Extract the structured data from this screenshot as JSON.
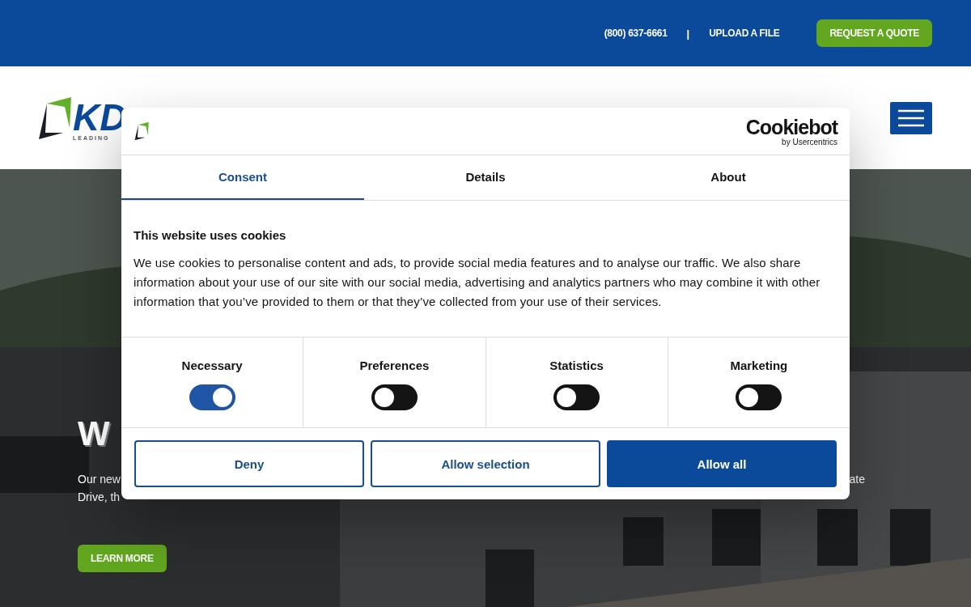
{
  "top_bar": {
    "phone": "(800) 637-6661",
    "separator": "|",
    "upload_link": "UPLOAD A FILE",
    "quote_button": "REQUEST A QUOTE"
  },
  "header": {
    "logo_letters": "KD",
    "logo_tagline": "LEADING"
  },
  "hero": {
    "heading": "W",
    "line_1_left": "Our new",
    "line_1_right": "ate",
    "line_2_left": "Drive, th",
    "button": "LEARN MORE"
  },
  "cookie_dialog": {
    "brand": "Cookiebot",
    "brand_sub": "by Usercentrics",
    "tabs": [
      {
        "label": "Consent",
        "selected": true
      },
      {
        "label": "Details",
        "selected": false
      },
      {
        "label": "About",
        "selected": false
      }
    ],
    "title": "This website uses cookies",
    "body": "We use cookies to personalise content and ads, to provide social media features and to analyse our traffic. We also share information about your use of our site with our social media, advertising and analytics partners who may combine it with other information that you’ve provided to them or that they’ve collected from your use of their services.",
    "categories": [
      {
        "label": "Necessary",
        "on": true
      },
      {
        "label": "Preferences",
        "on": false
      },
      {
        "label": "Statistics",
        "on": false
      },
      {
        "label": "Marketing",
        "on": false
      }
    ],
    "buttons": [
      {
        "label": "Deny",
        "kind": "outline"
      },
      {
        "label": "Allow selection",
        "kind": "outline"
      },
      {
        "label": "Allow all",
        "kind": "filled"
      }
    ]
  }
}
